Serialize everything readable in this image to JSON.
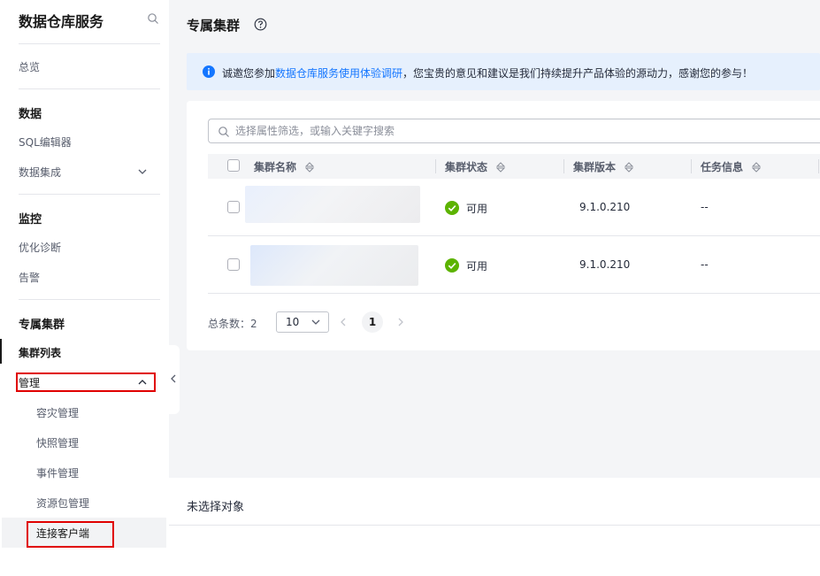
{
  "sidebar": {
    "title": "数据仓库服务",
    "overview": "总览",
    "groups": {
      "data": "数据",
      "monitor": "监控",
      "dedicated": "专属集群"
    },
    "items": {
      "sql_editor": "SQL编辑器",
      "data_integration": "数据集成",
      "optimize": "优化诊断",
      "alarm": "告警",
      "cluster_list": "集群列表",
      "manage": "管理"
    },
    "manage_sub": {
      "dr": "容灾管理",
      "snapshot": "快照管理",
      "event": "事件管理",
      "resource_pkg": "资源包管理",
      "connect_client": "连接客户端"
    }
  },
  "main": {
    "page_title": "专属集群",
    "notice": {
      "prefix": "诚邀您参加",
      "link": "数据仓库服务使用体验调研",
      "suffix": "，您宝贵的意见和建议是我们持续提升产品体验的源动力，感谢您的参与！"
    },
    "search_placeholder": "选择属性筛选，或输入关键字搜索",
    "columns": {
      "name": "集群名称",
      "status": "集群状态",
      "version": "集群版本",
      "task": "任务信息"
    },
    "rows": [
      {
        "status": "可用",
        "version": "9.1.0.210",
        "task": "--"
      },
      {
        "status": "可用",
        "version": "9.1.0.210",
        "task": "--"
      }
    ],
    "pagination": {
      "total_label": "总条数：2",
      "page_size": "10",
      "current_page": "1"
    },
    "bottom_panel": "未选择对象"
  },
  "colors": {
    "accent": "#1476ff",
    "success": "#5cb300",
    "highlight_box": "#e00000"
  }
}
